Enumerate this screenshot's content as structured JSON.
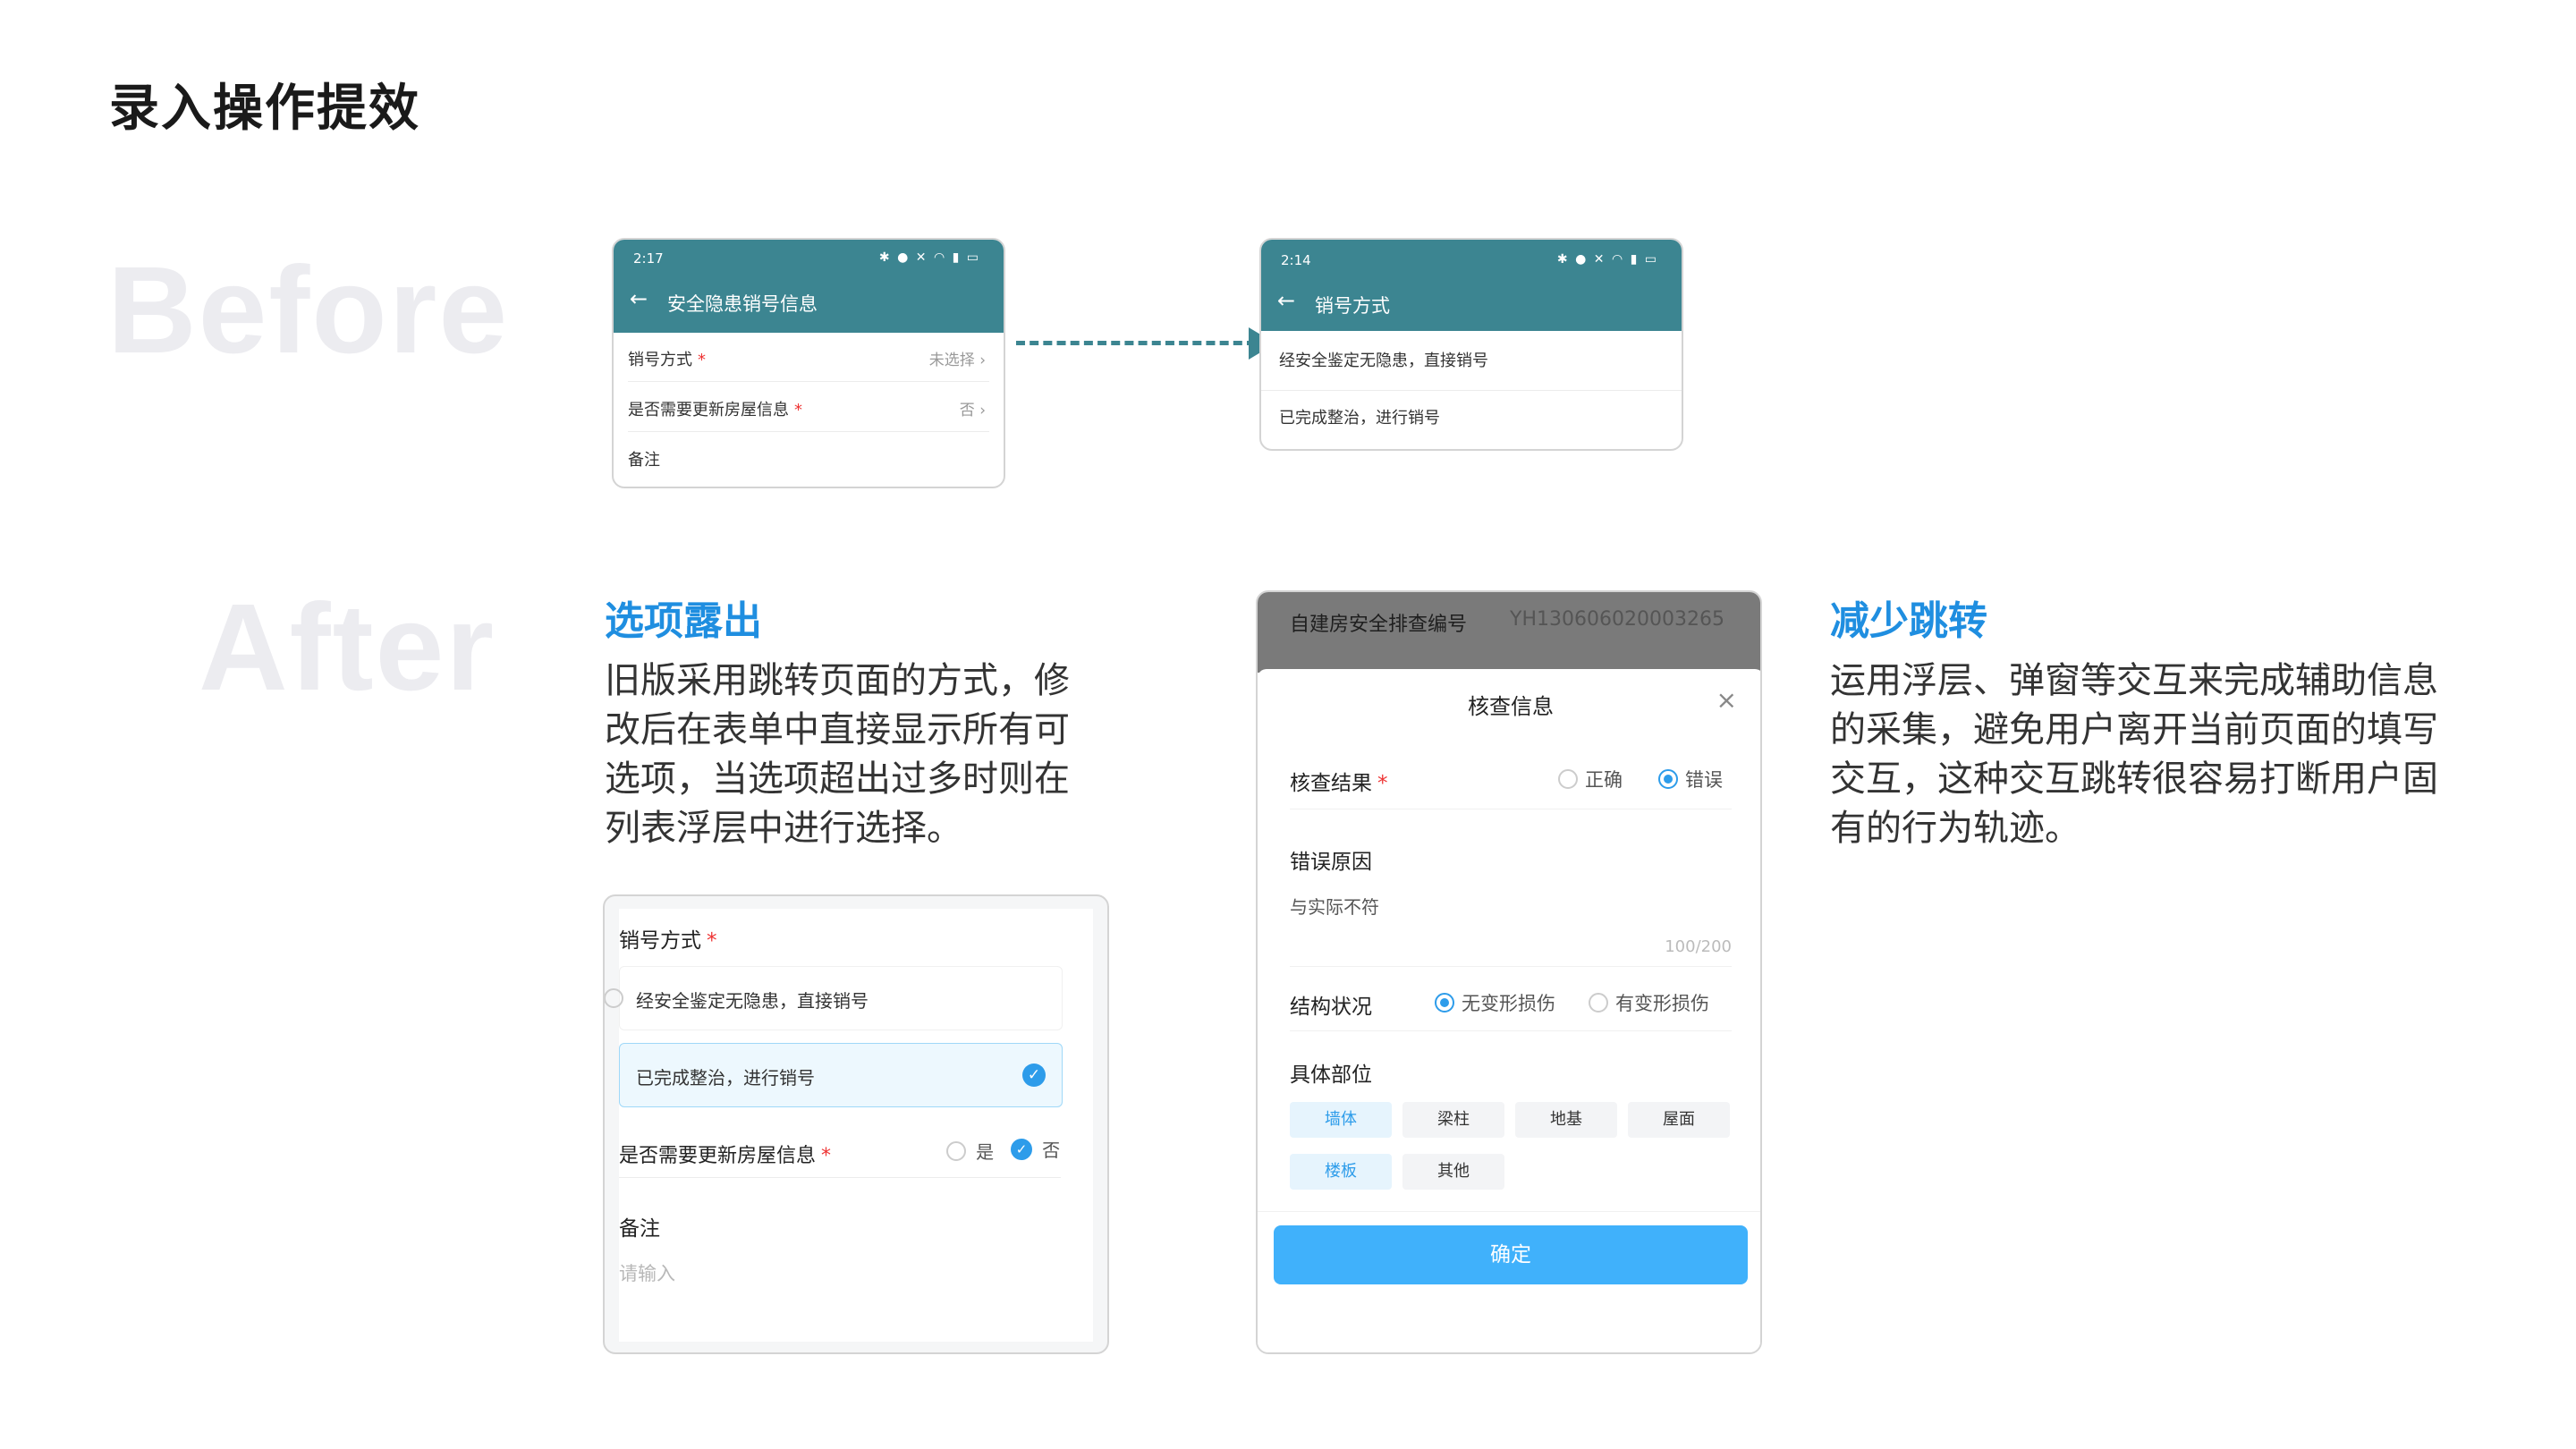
{
  "page": {
    "title": "录入操作提效"
  },
  "labels": {
    "before": "Before",
    "after": "After"
  },
  "before_screen1": {
    "time": "2:17",
    "status_icons": "✱ ● ✕ ◠ ▮ ▭",
    "nav_title": "安全隐患销号信息",
    "rows": [
      {
        "label": "销号方式",
        "required": "*",
        "value": "未选择 ›"
      },
      {
        "label": "是否需要更新房屋信息",
        "required": "*",
        "value": "否 ›"
      },
      {
        "label": "备注"
      }
    ]
  },
  "before_screen2": {
    "time": "2:14",
    "status_icons": "✱ ● ✕ ◠ ▮ ▭",
    "nav_title": "销号方式",
    "options": [
      "经安全鉴定无隐患，直接销号",
      "已完成整治，进行销号"
    ]
  },
  "after_left": {
    "heading": "选项露出",
    "description": [
      "旧版采用跳转页面的方式，修",
      "改后在表单中直接显示所有可",
      "选项，当选项超出过多时则在",
      "列表浮层中进行选择。"
    ],
    "form": {
      "field1_label": "销号方式",
      "required": "*",
      "options": [
        {
          "label": "经安全鉴定无隐患，直接销号",
          "selected": false
        },
        {
          "label": "已完成整治，进行销号",
          "selected": true
        }
      ],
      "field2_label": "是否需要更新房屋信息",
      "field2_yes": "是",
      "field2_no": "否",
      "field2_selected": "否",
      "remark_label": "备注",
      "remark_placeholder": "请输入"
    }
  },
  "after_right": {
    "heading": "减少跳转",
    "description": [
      "运用浮层、弹窗等交互来完成辅助信息",
      "的采集，避免用户离开当前页面的填写",
      "交互，这种交互跳转很容易打断用户固",
      "有的行为轨迹。"
    ],
    "dialog": {
      "top_label": "自建房安全排查编号",
      "top_value": "YH130606020003265",
      "title": "核查信息",
      "close": "×",
      "result_label": "核查结果",
      "required": "*",
      "result_options": [
        "正确",
        "错误"
      ],
      "result_selected": "错误",
      "reason_label": "错误原因",
      "reason_value": "与实际不符",
      "reason_count": "100/200",
      "structure_label": "结构状况",
      "structure_options": [
        "无变形损伤",
        "有变形损伤"
      ],
      "structure_selected": "无变形损伤",
      "part_label": "具体部位",
      "parts": [
        {
          "label": "墙体",
          "selected": true
        },
        {
          "label": "梁柱",
          "selected": false
        },
        {
          "label": "地基",
          "selected": false
        },
        {
          "label": "屋面",
          "selected": false
        },
        {
          "label": "楼板",
          "selected": true
        },
        {
          "label": "其他",
          "selected": false
        }
      ],
      "confirm": "确定"
    }
  },
  "colors": {
    "nav": "#3c8591",
    "accent": "#1f8ee0",
    "button": "#40b1fb",
    "check": "#2d9cea"
  }
}
